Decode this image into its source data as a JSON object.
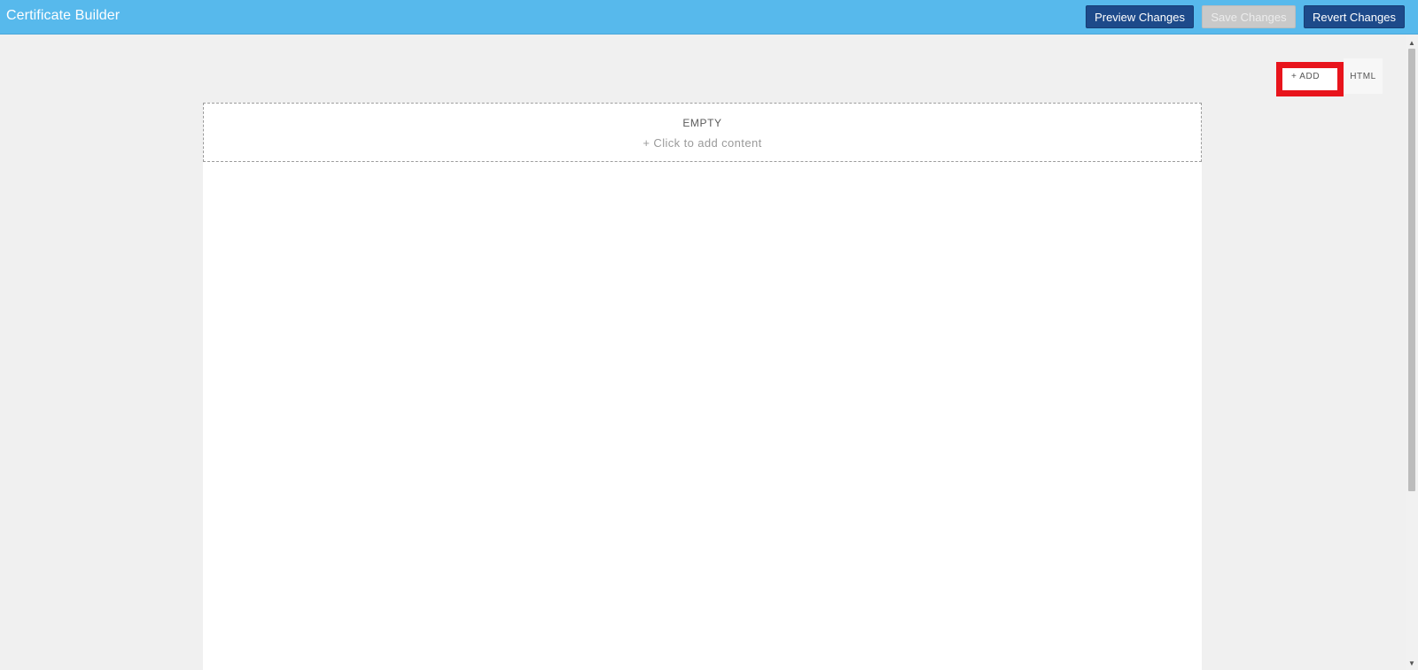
{
  "header": {
    "title": "Certificate Builder",
    "buttons": {
      "preview": "Preview Changes",
      "save": "Save Changes",
      "revert": "Revert Changes"
    }
  },
  "toolbar": {
    "add_label": "+ ADD",
    "html_label": "HTML"
  },
  "canvas": {
    "empty_label": "EMPTY",
    "empty_hint": "+ Click to add content"
  },
  "colors": {
    "header_bg": "#57b9ec",
    "primary_button": "#1d4a8a",
    "disabled_button": "#c9c9c9",
    "highlight": "#e8141c",
    "page_bg": "#f0f0f0"
  },
  "icons": {
    "scroll_up": "▲",
    "scroll_down": "▼"
  }
}
